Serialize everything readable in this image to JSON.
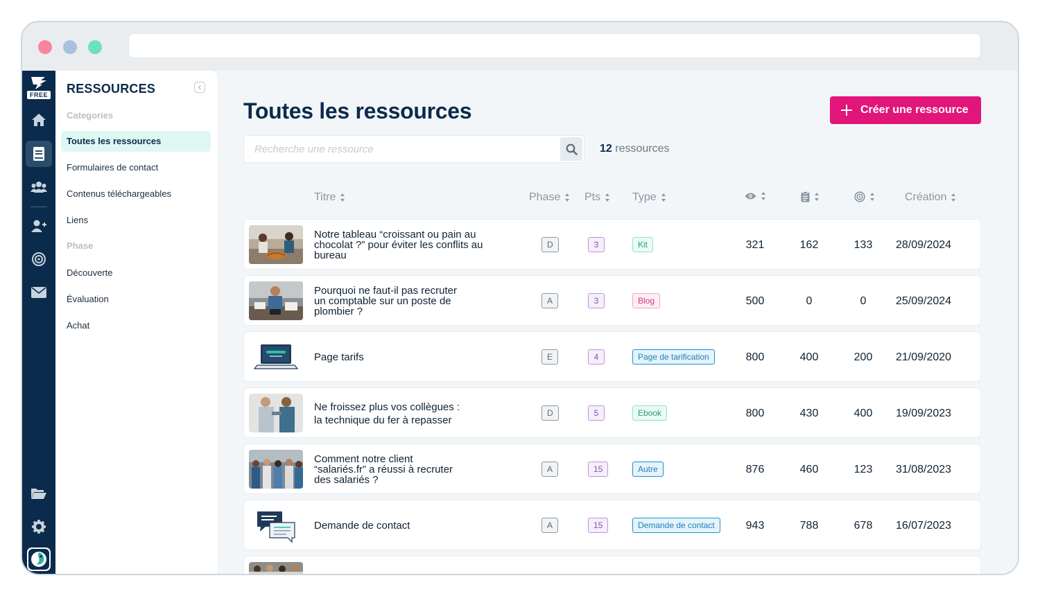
{
  "sidebar": {
    "title": "RESSOURCES",
    "free_badge": "FREE",
    "section_categories": "Categories",
    "categories": [
      "Toutes les ressources",
      "Formulaires de contact",
      "Contenus téléchargeables",
      "Liens"
    ],
    "section_phase": "Phase",
    "phases": [
      "Découverte",
      "Évaluation",
      "Achat"
    ]
  },
  "rail_icons": [
    "home-icon",
    "book-icon",
    "users-icon",
    "user-plus-icon",
    "target-icon",
    "mail-icon",
    "folder-open-icon",
    "gear-icon"
  ],
  "main": {
    "title": "Toutes les ressources",
    "create_label": "Créer une ressource",
    "search_placeholder": "Recherche une ressource",
    "count_value": "12",
    "count_label": " ressources"
  },
  "table": {
    "headers": {
      "title": "Titre",
      "phase": "Phase",
      "pts": "Pts",
      "type": "Type",
      "creation": "Création"
    },
    "header_icons": [
      "eye-icon",
      "clipboard-icon",
      "target-icon"
    ],
    "rows": [
      {
        "title_lines": [
          "Notre tableau “croissant ou pain au",
          "chocolat ?” pour éviter les conflits au",
          "bureau"
        ],
        "phase": "D",
        "pts": "3",
        "type": "Kit",
        "type_style": "teal",
        "views": "321",
        "downloads": "162",
        "conversions": "133",
        "date": "28/09/2024"
      },
      {
        "title_lines": [
          "Pourquoi ne faut-il pas recruter",
          "un comptable sur un poste de",
          "plombier ?"
        ],
        "phase": "A",
        "pts": "3",
        "type": "Blog",
        "type_style": "pink",
        "views": "500",
        "downloads": "0",
        "conversions": "0",
        "date": "25/09/2024"
      },
      {
        "title_lines": [
          "Page tarifs"
        ],
        "phase": "E",
        "pts": "4",
        "type": "Page de tarification",
        "type_style": "blue",
        "views": "800",
        "downloads": "400",
        "conversions": "200",
        "date": "21/09/2020"
      },
      {
        "title_lines": [
          "Ne froissez plus vos collègues :",
          "la technique du fer à repasser"
        ],
        "phase": "D",
        "pts": "5",
        "type": "Ebook",
        "type_style": "teal",
        "views": "800",
        "downloads": "430",
        "conversions": "400",
        "date": "19/09/2023"
      },
      {
        "title_lines": [
          "Comment notre client",
          "“salariés.fr” a réussi à recruter",
          "des salariés ?"
        ],
        "phase": "A",
        "pts": "15",
        "type": "Autre",
        "type_style": "blue",
        "views": "876",
        "downloads": "460",
        "conversions": "123",
        "date": "31/08/2023"
      },
      {
        "title_lines": [
          "Demande de contact"
        ],
        "phase": "A",
        "pts": "15",
        "type": "Demande de contact",
        "type_style": "blue",
        "views": "943",
        "downloads": "788",
        "conversions": "678",
        "date": "16/07/2023"
      }
    ]
  },
  "colors": {
    "rail": "#0b2b4c",
    "accent": "#e1157a",
    "active_item_bg": "#dff7f3"
  }
}
